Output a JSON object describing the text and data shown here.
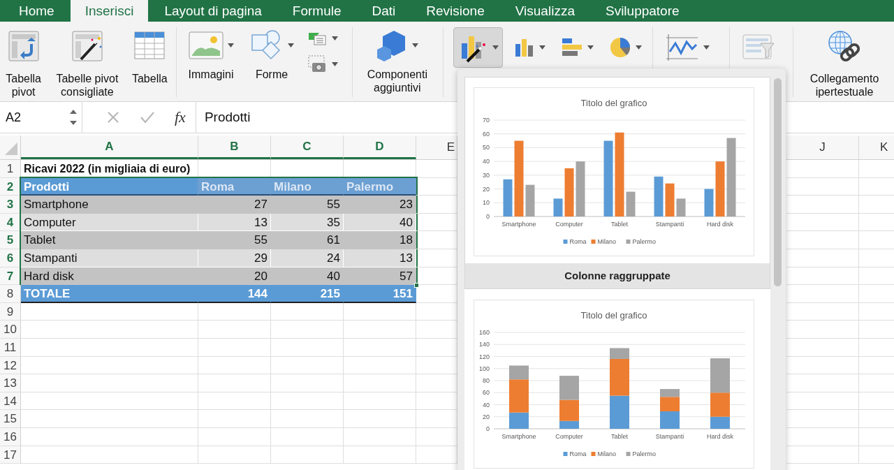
{
  "tabs": [
    {
      "label": "Home",
      "selected": false
    },
    {
      "label": "Inserisci",
      "selected": true
    },
    {
      "label": "Layout di pagina",
      "selected": false
    },
    {
      "label": "Formule",
      "selected": false
    },
    {
      "label": "Dati",
      "selected": false
    },
    {
      "label": "Revisione",
      "selected": false
    },
    {
      "label": "Visualizza",
      "selected": false
    },
    {
      "label": "Sviluppatore",
      "selected": false
    }
  ],
  "ribbon": {
    "pivot": {
      "label": "Tabella\npivot"
    },
    "recommended_pivot": {
      "label": "Tabelle pivot\nconsigliate"
    },
    "table": {
      "label": "Tabella"
    },
    "images": {
      "label": "Immagini"
    },
    "shapes": {
      "label": "Forme"
    },
    "addins": {
      "label": "Componenti\naggiuntivi"
    },
    "recommended_charts": {
      "selected": true
    },
    "hyperlink": {
      "label": "Collegamento\nipertestuale"
    }
  },
  "formula_bar": {
    "name_box": "A2",
    "fx": "fx",
    "value": "Prodotti"
  },
  "sheet": {
    "columns": [
      {
        "label": "A",
        "selected": true
      },
      {
        "label": "B",
        "selected": true
      },
      {
        "label": "C",
        "selected": true
      },
      {
        "label": "D",
        "selected": true
      },
      {
        "label": "E",
        "selected": false
      },
      {
        "label": "J",
        "selected": false
      },
      {
        "label": "K",
        "selected": false
      }
    ],
    "rows": [
      {
        "number": "1",
        "selected": false,
        "kind": "title",
        "cells": [
          "Ricavi 2022 (in migliaia di euro)"
        ]
      },
      {
        "number": "2",
        "selected": true,
        "kind": "header",
        "cells": [
          "Prodotti",
          "Roma",
          "Milano",
          "Palermo"
        ]
      },
      {
        "number": "3",
        "selected": true,
        "kind": "data",
        "shaded": true,
        "cells": [
          "Smartphone",
          "27",
          "55",
          "23"
        ]
      },
      {
        "number": "4",
        "selected": true,
        "kind": "data",
        "shaded": false,
        "cells": [
          "Computer",
          "13",
          "35",
          "40"
        ]
      },
      {
        "number": "5",
        "selected": true,
        "kind": "data",
        "shaded": true,
        "cells": [
          "Tablet",
          "55",
          "61",
          "18"
        ]
      },
      {
        "number": "6",
        "selected": true,
        "kind": "data",
        "shaded": false,
        "cells": [
          "Stampanti",
          "29",
          "24",
          "13"
        ]
      },
      {
        "number": "7",
        "selected": true,
        "kind": "data",
        "shaded": true,
        "cells": [
          "Hard disk",
          "20",
          "40",
          "57"
        ]
      },
      {
        "number": "8",
        "selected": false,
        "kind": "total",
        "cells": [
          "TOTALE",
          "144",
          "215",
          "151"
        ]
      },
      {
        "number": "9",
        "selected": false,
        "kind": "empty"
      },
      {
        "number": "10",
        "selected": false,
        "kind": "empty"
      },
      {
        "number": "11",
        "selected": false,
        "kind": "empty"
      },
      {
        "number": "12",
        "selected": false,
        "kind": "empty"
      },
      {
        "number": "13",
        "selected": false,
        "kind": "empty"
      },
      {
        "number": "14",
        "selected": false,
        "kind": "empty"
      },
      {
        "number": "15",
        "selected": false,
        "kind": "empty"
      },
      {
        "number": "16",
        "selected": false,
        "kind": "empty"
      },
      {
        "number": "17",
        "selected": false,
        "kind": "empty"
      }
    ]
  },
  "chart_gallery": [
    {
      "selected": true,
      "label": "Colonne raggruppate",
      "chart_data": {
        "type": "bar",
        "title": "Titolo del grafico",
        "categories": [
          "Smartphone",
          "Computer",
          "Tablet",
          "Stampanti",
          "Hard disk"
        ],
        "series": [
          {
            "name": "Roma",
            "color": "#5b9bd5",
            "values": [
              27,
              13,
              55,
              29,
              20
            ]
          },
          {
            "name": "Milano",
            "color": "#ed7d31",
            "values": [
              55,
              35,
              61,
              24,
              40
            ]
          },
          {
            "name": "Palermo",
            "color": "#a5a5a5",
            "values": [
              23,
              40,
              18,
              13,
              57
            ]
          }
        ],
        "ylim": [
          0,
          70
        ],
        "yticks": [
          0,
          10,
          20,
          30,
          40,
          50,
          60,
          70
        ],
        "stacked": false,
        "grid": true,
        "legend": "bottom"
      }
    },
    {
      "selected": false,
      "chart_data": {
        "type": "bar",
        "title": "Titolo del grafico",
        "categories": [
          "Smartphone",
          "Computer",
          "Tablet",
          "Stampanti",
          "Hard disk"
        ],
        "series": [
          {
            "name": "Roma",
            "color": "#5b9bd5",
            "values": [
              27,
              13,
              55,
              29,
              20
            ]
          },
          {
            "name": "Milano",
            "color": "#ed7d31",
            "values": [
              55,
              35,
              61,
              24,
              40
            ]
          },
          {
            "name": "Palermo",
            "color": "#a5a5a5",
            "values": [
              23,
              40,
              18,
              13,
              57
            ]
          }
        ],
        "ylim": [
          0,
          160
        ],
        "yticks": [
          0,
          20,
          40,
          60,
          80,
          100,
          120,
          140,
          160
        ],
        "stacked": true,
        "grid": true,
        "legend": "bottom"
      }
    }
  ]
}
